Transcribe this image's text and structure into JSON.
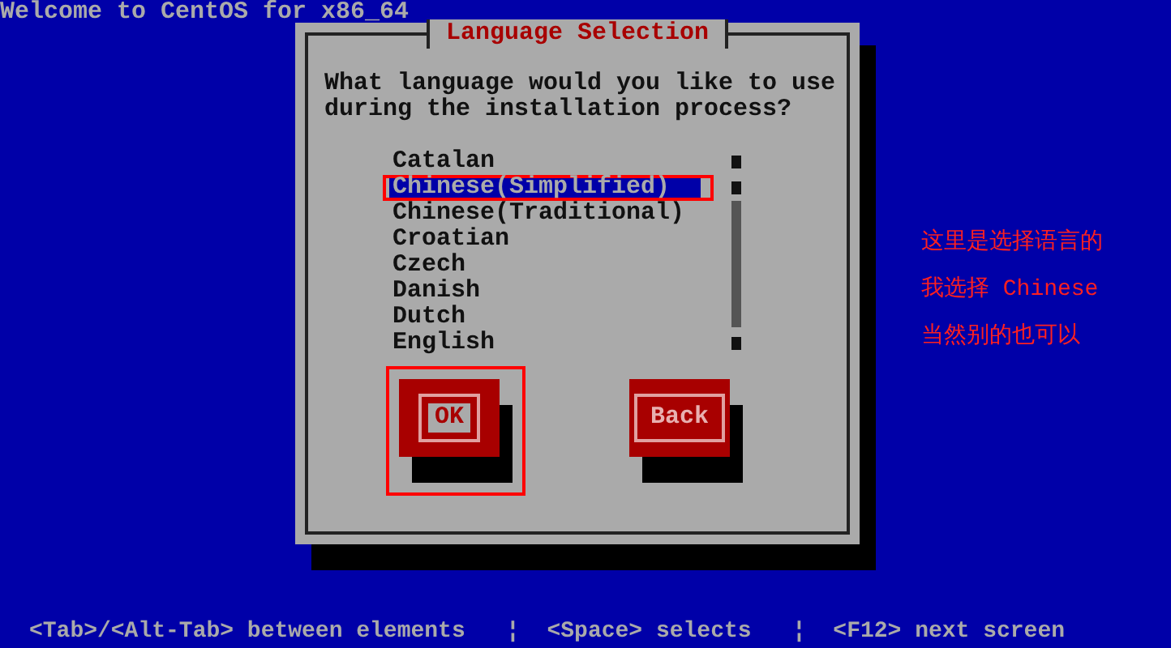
{
  "header": "Welcome to CentOS for x86_64",
  "dialog": {
    "title": "Language Selection",
    "prompt": "What language would you like to use during the installation process?",
    "languages": [
      {
        "label": "Catalan",
        "selected": false,
        "annotated": false
      },
      {
        "label": "Chinese(Simplified)",
        "selected": true,
        "annotated": true
      },
      {
        "label": "Chinese(Traditional)",
        "selected": false,
        "annotated": false
      },
      {
        "label": "Croatian",
        "selected": false,
        "annotated": false
      },
      {
        "label": "Czech",
        "selected": false,
        "annotated": false
      },
      {
        "label": "Danish",
        "selected": false,
        "annotated": false
      },
      {
        "label": "Dutch",
        "selected": false,
        "annotated": false
      },
      {
        "label": "English",
        "selected": false,
        "annotated": false
      }
    ],
    "buttons": [
      {
        "label": "OK",
        "focused": true,
        "annotated": true
      },
      {
        "label": "Back",
        "focused": false,
        "annotated": false
      }
    ]
  },
  "annotation_lines": [
    "这里是选择语言的",
    "我选择 Chinese",
    "当然别的也可以"
  ],
  "status_bar": "<Tab>/<Alt-Tab> between elements   ¦  <Space> selects   ¦  <F12> next screen"
}
